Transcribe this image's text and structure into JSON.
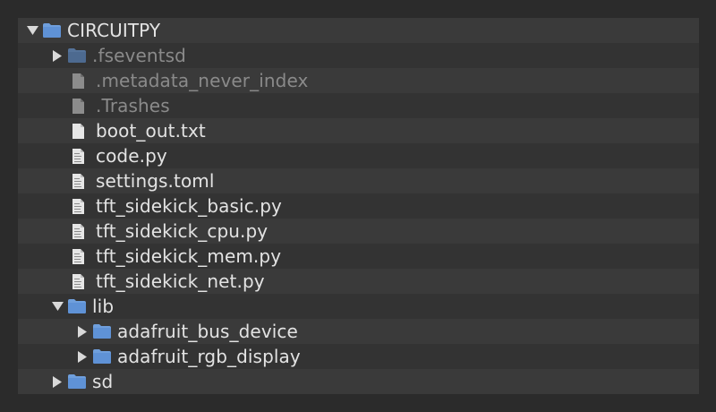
{
  "tree": [
    {
      "name": "CIRCUITPY",
      "type": "folder",
      "expanded": true,
      "level": 0,
      "hidden": false
    },
    {
      "name": ".fseventsd",
      "type": "folder",
      "expanded": false,
      "level": 1,
      "hidden": true
    },
    {
      "name": ".metadata_never_index",
      "type": "file",
      "level": 1,
      "hidden": true
    },
    {
      "name": ".Trashes",
      "type": "file",
      "level": 1,
      "hidden": true
    },
    {
      "name": "boot_out.txt",
      "type": "file",
      "level": 1,
      "hidden": false
    },
    {
      "name": "code.py",
      "type": "script",
      "level": 1,
      "hidden": false
    },
    {
      "name": "settings.toml",
      "type": "script",
      "level": 1,
      "hidden": false
    },
    {
      "name": "tft_sidekick_basic.py",
      "type": "script",
      "level": 1,
      "hidden": false
    },
    {
      "name": "tft_sidekick_cpu.py",
      "type": "script",
      "level": 1,
      "hidden": false
    },
    {
      "name": "tft_sidekick_mem.py",
      "type": "script",
      "level": 1,
      "hidden": false
    },
    {
      "name": "tft_sidekick_net.py",
      "type": "script",
      "level": 1,
      "hidden": false
    },
    {
      "name": "lib",
      "type": "folder",
      "expanded": true,
      "level": 1,
      "hidden": false
    },
    {
      "name": "adafruit_bus_device",
      "type": "folder",
      "expanded": false,
      "level": 2,
      "hidden": false
    },
    {
      "name": "adafruit_rgb_display",
      "type": "folder",
      "expanded": false,
      "level": 2,
      "hidden": false
    },
    {
      "name": "sd",
      "type": "folder",
      "expanded": false,
      "level": 1,
      "hidden": false
    }
  ],
  "colors": {
    "folder": "#6f9fdc",
    "folder_dim": "#55739a",
    "file": "#e6e6e6",
    "file_dim": "#8c8c8c",
    "text": "#e3e3e3",
    "text_dim": "#8a8a8a"
  }
}
